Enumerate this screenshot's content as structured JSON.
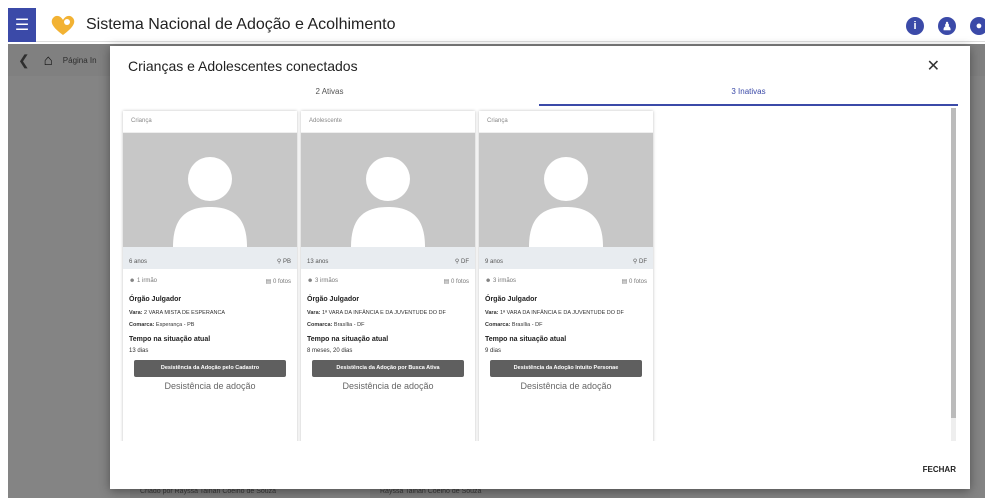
{
  "app": {
    "title": "Sistema Nacional de Adoção e Acolhimento",
    "breadcrumb": "Página In"
  },
  "background": {
    "left_strip": "Criado por Rayssa Tainan Coêlho de Souza",
    "right_strip": "Rayssa Tainan Coêlho de Souza"
  },
  "modal": {
    "title": "Crianças e Adolescentes conectados",
    "tabs": [
      {
        "label": "2 Ativas",
        "active": false
      },
      {
        "label": "3 Inativas",
        "active": true
      }
    ],
    "footer_button": "FECHAR"
  },
  "cards": [
    {
      "type": "Criança",
      "age": "6 anos",
      "uf": "PB",
      "siblings": "1 irmão",
      "photos": "0 fotos",
      "org_label": "Órgão Julgador",
      "vara_label": "Vara:",
      "vara_value": "2 VARA MISTA DE ESPERANCA",
      "comarca_label": "Comarca:",
      "comarca_value": "Esperança - PB",
      "tempo_label": "Tempo na situação atual",
      "tempo_value": "13 dias",
      "action": "Desistência da Adoção pelo Cadastro",
      "status": "Desistência de adoção"
    },
    {
      "type": "Adolescente",
      "age": "13 anos",
      "uf": "DF",
      "siblings": "3 irmãos",
      "photos": "0 fotos",
      "org_label": "Órgão Julgador",
      "vara_label": "Vara:",
      "vara_value": "1ª VARA DA INFÂNCIA E DA JUVENTUDE DO DF",
      "comarca_label": "Comarca:",
      "comarca_value": "Brasília - DF",
      "tempo_label": "Tempo na situação atual",
      "tempo_value": "8 meses, 20 dias",
      "action": "Desistência da Adoção por Busca Ativa",
      "status": "Desistência de adoção"
    },
    {
      "type": "Criança",
      "age": "9 anos",
      "uf": "DF",
      "siblings": "3 irmãos",
      "photos": "0 fotos",
      "org_label": "Órgão Julgador",
      "vara_label": "Vara:",
      "vara_value": "1ª VARA DA INFÂNCIA E DA JUVENTUDE DO DF",
      "comarca_label": "Comarca:",
      "comarca_value": "Brasília - DF",
      "tempo_label": "Tempo na situação atual",
      "tempo_value": "9 dias",
      "action": "Desistência da Adoção Intuito Personae",
      "status": "Desistência de adoção"
    }
  ]
}
